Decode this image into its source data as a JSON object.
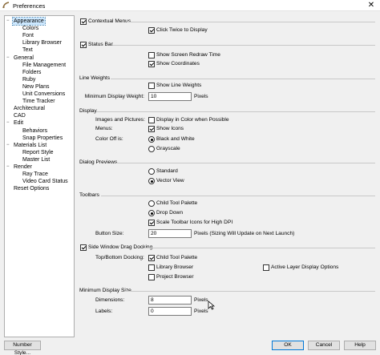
{
  "window": {
    "title": "Preferences",
    "close_label": "✕"
  },
  "tree": [
    {
      "label": "Appearance",
      "expander": "−",
      "selected": true
    },
    {
      "label": "Colors"
    },
    {
      "label": "Font"
    },
    {
      "label": "Library Browser"
    },
    {
      "label": "Text"
    },
    {
      "label": "General",
      "expander": "−"
    },
    {
      "label": "File Management"
    },
    {
      "label": "Folders"
    },
    {
      "label": "Ruby"
    },
    {
      "label": "New Plans"
    },
    {
      "label": "Unit Conversions"
    },
    {
      "label": "Time Tracker"
    },
    {
      "label": "Architectural"
    },
    {
      "label": "CAD"
    },
    {
      "label": "Edit",
      "expander": "−"
    },
    {
      "label": "Behaviors"
    },
    {
      "label": "Snap Properties"
    },
    {
      "label": "Materials List",
      "expander": "−"
    },
    {
      "label": "Report Style"
    },
    {
      "label": "Master List"
    },
    {
      "label": "Render",
      "expander": "−"
    },
    {
      "label": "Ray Trace"
    },
    {
      "label": "Video Card Status"
    },
    {
      "label": "Reset Options"
    }
  ],
  "contextual_menus": {
    "label": "Contextual Menus",
    "checked": true,
    "click_twice": {
      "label": "Click Twice to Display",
      "checked": true
    }
  },
  "status_bar": {
    "label": "Status Bar",
    "checked": true,
    "redraw": {
      "label": "Show Screen Redraw Time",
      "checked": false
    },
    "coords": {
      "label": "Show Coordinates",
      "checked": true
    }
  },
  "line_weights": {
    "heading": "Line Weights",
    "show": {
      "label": "Show Line Weights",
      "checked": false
    },
    "min_label": "Minimum Display Weight:",
    "min_value": "10",
    "unit": "Pixels"
  },
  "display": {
    "heading": "Display",
    "images_label": "Images and Pictures:",
    "images_color": {
      "label": "Display in Color when Possible",
      "checked": false
    },
    "menus_label": "Menus:",
    "show_icons": {
      "label": "Show Icons",
      "checked": true
    },
    "color_off_label": "Color Off is:",
    "black_white": {
      "label": "Black and White",
      "checked": true
    },
    "grayscale": {
      "label": "Grayscale",
      "checked": false
    }
  },
  "dialog_previews": {
    "heading": "Dialog Previews",
    "standard": {
      "label": "Standard",
      "checked": false
    },
    "vector": {
      "label": "Vector View",
      "checked": true
    }
  },
  "toolbars": {
    "heading": "Toolbars",
    "child": {
      "label": "Child Tool Palette",
      "checked": false
    },
    "dropdown": {
      "label": "Drop Down",
      "checked": true
    },
    "scale": {
      "label": "Scale Toolbar Icons for High DPI",
      "checked": true
    },
    "button_size_label": "Button Size:",
    "button_size_value": "20",
    "button_size_note": "Pixels (Sizing Will Update on Next Launch)"
  },
  "side_docking": {
    "label": "Side Window Drag Docking",
    "checked": true,
    "top_bottom_label": "Top/Bottom Docking:",
    "child": {
      "label": "Child Tool Palette",
      "checked": true
    },
    "library": {
      "label": "Library Browser",
      "checked": false
    },
    "active_layer": {
      "label": "Active Layer Display Options",
      "checked": false
    },
    "project": {
      "label": "Project Browser",
      "checked": false
    }
  },
  "min_display_size": {
    "heading": "Minimum Display Size",
    "dimensions_label": "Dimensions:",
    "dimensions_value": "8",
    "dimensions_unit": "Pixels",
    "labels_label": "Labels:",
    "labels_value": "0",
    "labels_unit": "Pixels"
  },
  "footer": {
    "number_style": "Number Style...",
    "ok": "OK",
    "cancel": "Cancel",
    "help": "Help"
  }
}
